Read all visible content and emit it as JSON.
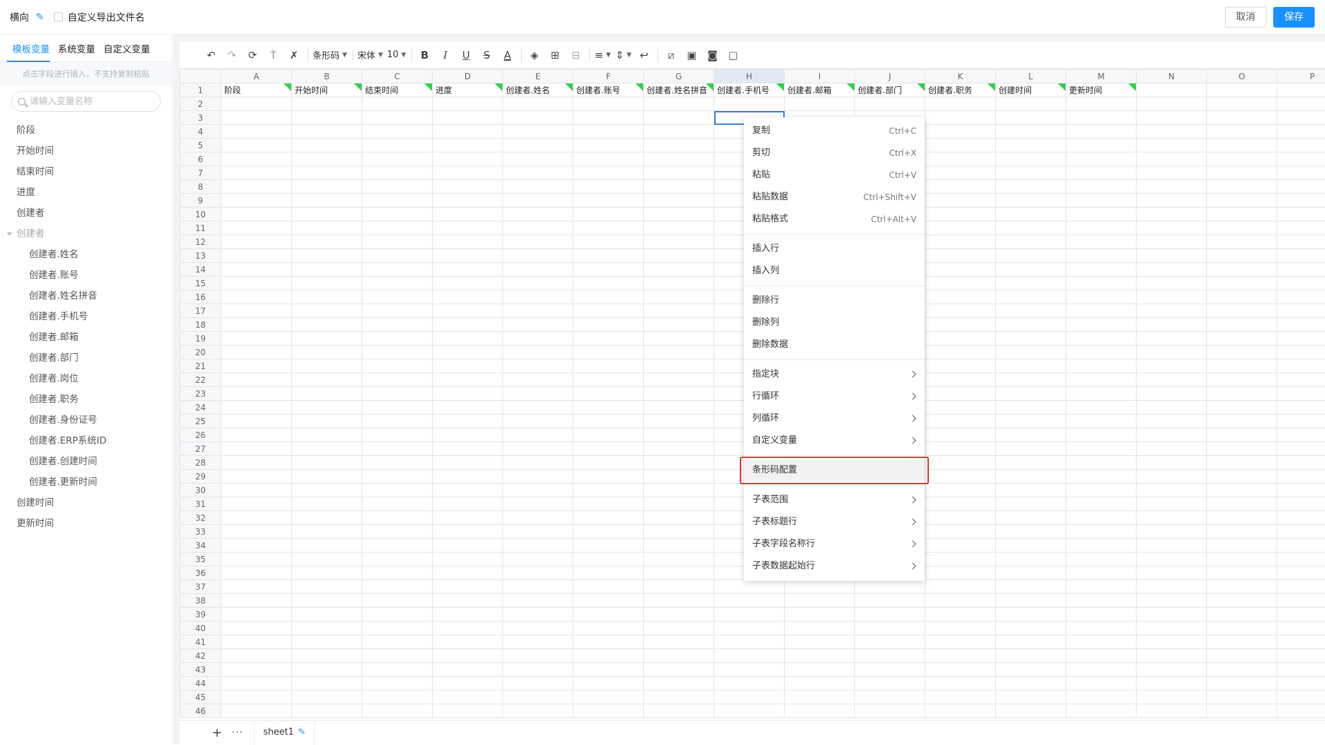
{
  "topbar": {
    "title": "横向",
    "checkbox_label": "自定义导出文件名",
    "cancel_label": "取消",
    "save_label": "保存"
  },
  "sidebar": {
    "tabs": [
      "模板变量",
      "系统变量",
      "自定义变量"
    ],
    "hint": "点击字段进行插入，不支持复制粘贴",
    "search_placeholder": "请输入变量名称",
    "items": [
      {
        "label": "阶段"
      },
      {
        "label": "开始时间"
      },
      {
        "label": "结束时间"
      },
      {
        "label": "进度"
      },
      {
        "label": "创建者"
      },
      {
        "label": "创建者"
      },
      {
        "label": "创建者.姓名"
      },
      {
        "label": "创建者.账号"
      },
      {
        "label": "创建者.姓名拼音"
      },
      {
        "label": "创建者.手机号"
      },
      {
        "label": "创建者.邮箱"
      },
      {
        "label": "创建者.部门"
      },
      {
        "label": "创建者.岗位"
      },
      {
        "label": "创建者.职务"
      },
      {
        "label": "创建者.身份证号"
      },
      {
        "label": "创建者.ERP系统ID"
      },
      {
        "label": "创建者.创建时间"
      },
      {
        "label": "创建者.更新时间"
      },
      {
        "label": "创建时间"
      },
      {
        "label": "更新时间"
      }
    ]
  },
  "toolbar": {
    "format_label": "条形码",
    "font_label": "宋体",
    "size_label": "10",
    "bold": "B",
    "italic": "I",
    "underline": "U",
    "strike": "S",
    "fontcolor": "A"
  },
  "grid": {
    "columns": [
      "A",
      "B",
      "C",
      "D",
      "E",
      "F",
      "G",
      "H",
      "I",
      "J",
      "K",
      "L",
      "M",
      "N",
      "O",
      "P"
    ],
    "row_count": 46,
    "header_row": [
      "阶段",
      "开始时间",
      "结束时间",
      "进度",
      "创建者.姓名",
      "创建者.账号",
      "创建者.姓名拼音",
      "创建者.手机号",
      "创建者.邮箱",
      "创建者.部门",
      "创建者.职务",
      "创建时间",
      "更新时间"
    ]
  },
  "sheet_tab": "sheet1",
  "context_menu": {
    "groups": [
      [
        {
          "label": "复制",
          "shortcut": "Ctrl+C"
        },
        {
          "label": "剪切",
          "shortcut": "Ctrl+X"
        },
        {
          "label": "粘贴",
          "shortcut": "Ctrl+V"
        },
        {
          "label": "粘贴数据",
          "shortcut": "Ctrl+Shift+V"
        },
        {
          "label": "粘贴格式",
          "shortcut": "Ctrl+Alt+V"
        }
      ],
      [
        {
          "label": "插入行"
        },
        {
          "label": "插入列"
        }
      ],
      [
        {
          "label": "删除行"
        },
        {
          "label": "删除列"
        },
        {
          "label": "删除数据"
        }
      ],
      [
        {
          "label": "指定块",
          "submenu": true
        },
        {
          "label": "行循环",
          "submenu": true
        },
        {
          "label": "列循环",
          "submenu": true
        },
        {
          "label": "自定义变量",
          "submenu": true
        }
      ],
      [
        {
          "label": "条形码配置",
          "highlighted": true
        }
      ],
      [
        {
          "label": "子表范围",
          "submenu": true
        },
        {
          "label": "子表标题行",
          "submenu": true
        },
        {
          "label": "子表字段名称行",
          "submenu": true
        },
        {
          "label": "子表数据起始行",
          "submenu": true
        }
      ]
    ]
  }
}
